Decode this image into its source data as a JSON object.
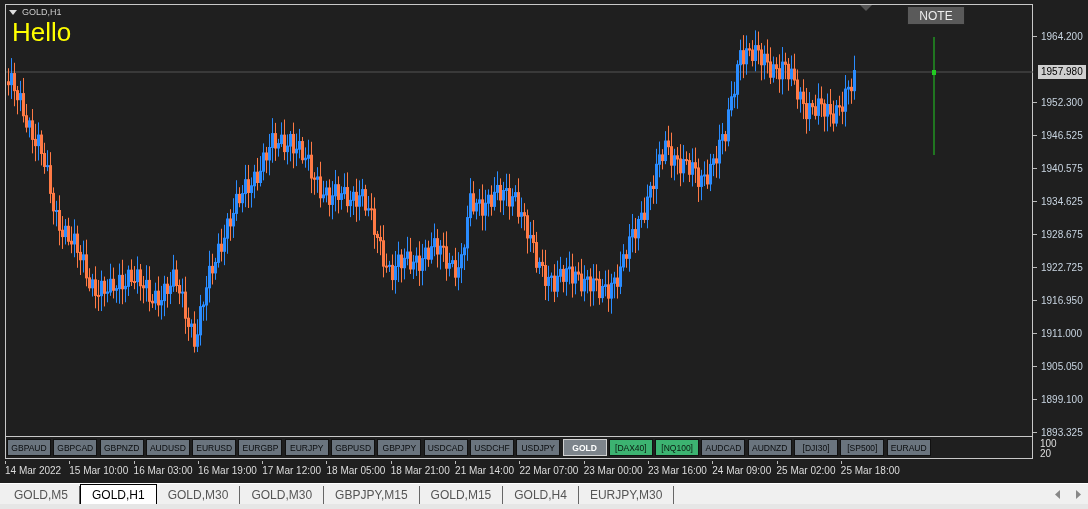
{
  "chart": {
    "title": "GOLD,H1",
    "note": "Hello",
    "note_button": "NOTE",
    "current_price": "1957.980",
    "price_ticks": [
      "1964.200",
      "1952.300",
      "1946.525",
      "1940.575",
      "1934.625",
      "1928.675",
      "1922.725",
      "1916.950",
      "1911.000",
      "1905.050",
      "1899.100",
      "1893.325"
    ],
    "time_labels": [
      "14 Mar 2022",
      "15 Mar 10:00",
      "16 Mar 03:00",
      "16 Mar 19:00",
      "17 Mar 12:00",
      "18 Mar 05:00",
      "18 Mar 21:00",
      "21 Mar 14:00",
      "22 Mar 07:00",
      "23 Mar 00:00",
      "23 Mar 16:00",
      "24 Mar 09:00",
      "25 Mar 02:00",
      "25 Mar 18:00"
    ]
  },
  "symbol_buttons": [
    {
      "label": "GBPAUD",
      "selected": false,
      "highlighted": false
    },
    {
      "label": "GBPCAD",
      "selected": false,
      "highlighted": false
    },
    {
      "label": "GBPNZD",
      "selected": false,
      "highlighted": false
    },
    {
      "label": "AUDUSD",
      "selected": false,
      "highlighted": false
    },
    {
      "label": "EURUSD",
      "selected": false,
      "highlighted": false
    },
    {
      "label": "EURGBP",
      "selected": false,
      "highlighted": false
    },
    {
      "label": "EURJPY",
      "selected": false,
      "highlighted": false
    },
    {
      "label": "GBPUSD",
      "selected": false,
      "highlighted": false
    },
    {
      "label": "GBPJPY",
      "selected": false,
      "highlighted": false
    },
    {
      "label": "USDCAD",
      "selected": false,
      "highlighted": false
    },
    {
      "label": "USDCHF",
      "selected": false,
      "highlighted": false
    },
    {
      "label": "USDJPY",
      "selected": false,
      "highlighted": false
    },
    {
      "label": "GOLD",
      "selected": true,
      "highlighted": false
    },
    {
      "label": "[DAX40]",
      "selected": false,
      "highlighted": true
    },
    {
      "label": "[NQ100]",
      "selected": false,
      "highlighted": true
    },
    {
      "label": "AUDCAD",
      "selected": false,
      "highlighted": false
    },
    {
      "label": "AUDNZD",
      "selected": false,
      "highlighted": false
    },
    {
      "label": "[DJI30]",
      "selected": false,
      "highlighted": false
    },
    {
      "label": "[SP500]",
      "selected": false,
      "highlighted": false
    },
    {
      "label": "EURAUD",
      "selected": false,
      "highlighted": false
    }
  ],
  "indicator_levels": [
    "100",
    "20"
  ],
  "tabs": [
    {
      "label": "GOLD,M5",
      "selected": false
    },
    {
      "label": "GOLD,H1",
      "selected": true
    },
    {
      "label": "GOLD,M30",
      "selected": false
    },
    {
      "label": "GOLD,M30",
      "selected": false
    },
    {
      "label": "GBPJPY,M15",
      "selected": false
    },
    {
      "label": "GOLD,M15",
      "selected": false
    },
    {
      "label": "GOLD,H4",
      "selected": false
    },
    {
      "label": "EURJPY,M30",
      "selected": false
    }
  ]
}
